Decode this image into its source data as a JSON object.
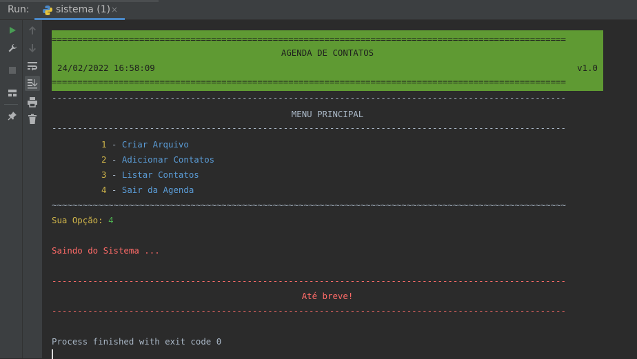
{
  "toolwindow": {
    "run_label": "Run:",
    "tab_label": "sistema (1)",
    "tab_close": "×"
  },
  "toolbar": {
    "icons": [
      "run-icon",
      "wrench-icon",
      "stop-icon",
      "layout-icon",
      "pin-icon",
      "up-arrow-icon",
      "down-arrow-icon",
      "soft-wrap-icon",
      "scroll-to-end-icon",
      "print-icon",
      "trash-icon"
    ]
  },
  "console": {
    "header": {
      "rule": "====================================================================================================",
      "title": "AGENDA DE CONTATOS",
      "datetime": "24/02/2022 16:58:09",
      "version": "v1.0"
    },
    "dash_rule": "----------------------------------------------------------------------------------------------------",
    "menu_title": "MENU PRINCIPAL",
    "menu_items": [
      {
        "num": "1",
        "sep": " - ",
        "label": "Criar Arquivo"
      },
      {
        "num": "2",
        "sep": " - ",
        "label": "Adicionar Contatos"
      },
      {
        "num": "3",
        "sep": " - ",
        "label": "Listar Contatos"
      },
      {
        "num": "4",
        "sep": " - ",
        "label": "Sair da Agenda"
      }
    ],
    "tilde_rule": "~~~~~~~~~~~~~~~~~~~~~~~~~~~~~~~~~~~~~~~~~~~~~~~~~~~~~~~~~~~~~~~~~~~~~~~~~~~~~~~~~~~~~~~~~~~~~~~~~~~~",
    "prompt": "Sua Opção: ",
    "answer": "4",
    "exit_message": "Saindo do Sistema ...",
    "farewell": "Até breve!",
    "process_finished": "Process finished with exit code 0"
  },
  "colors": {
    "header_bg": "#5f9a33",
    "number": "#d1b64a",
    "option": "#5a9bd5",
    "error": "#ff6b68",
    "answer": "#4caf50"
  }
}
